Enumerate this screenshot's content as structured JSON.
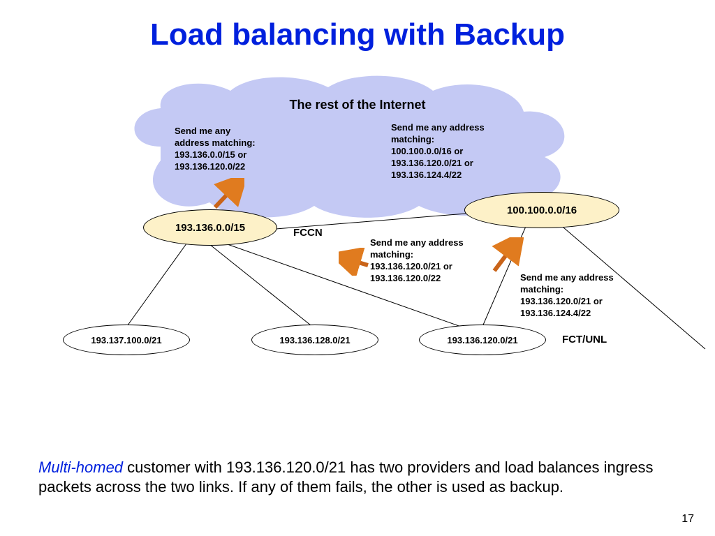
{
  "title": "Load balancing with Backup",
  "cloud": {
    "title": "The rest of the Internet",
    "left_text": "Send me any\naddress matching:\n193.136.0.0/15 or\n193.136.120.0/22",
    "right_text": "Send me any address\nmatching:\n100.100.0.0/16 or\n193.136.120.0/21 or\n193.136.124.4/22"
  },
  "nodes": {
    "isp_left": "193.136.0.0/15",
    "isp_right": "100.100.0.0/16",
    "child1": "193.137.100.0/21",
    "child2": "193.136.128.0/21",
    "child3": "193.136.120.0/21"
  },
  "labels": {
    "fccn": "FCCN",
    "fctunl": "FCT/UNL"
  },
  "mid_text_left": "Send me any address\nmatching:\n193.136.120.0/21 or\n193.136.120.0/22",
  "mid_text_right": "Send me any address\nmatching:\n193.136.120.0/21 or\n193.136.124.4/22",
  "body": {
    "emph": "Multi-homed",
    "rest": " customer with 193.136.120.0/21 has two providers and load balances ingress packets across the two links. If any of them fails, the other is used as backup."
  },
  "page": "17"
}
